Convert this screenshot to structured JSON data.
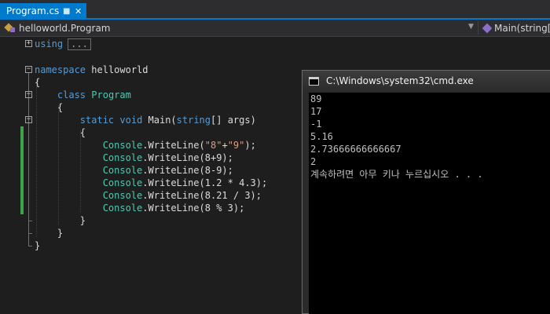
{
  "tabs": [
    {
      "label": "Program.cs",
      "pin_icon": "pin-icon",
      "close_icon": "close-icon"
    }
  ],
  "navbar": {
    "type_dropdown": "helloworld.Program",
    "member_dropdown": "Main(string[]"
  },
  "editor": {
    "using_keyword": "using",
    "using_collapsed": "...",
    "namespace_keyword": "namespace",
    "namespace_name": "helloworld",
    "class_keyword": "class",
    "class_name": "Program",
    "static_kw": "static",
    "void_kw": "void",
    "main_name": " Main(",
    "string_kw": "string",
    "args_text": "[] args)",
    "open_brace": "{",
    "close_brace": "}",
    "statements": [
      {
        "cls": "Console",
        "rest_pre": ".WriteLine(",
        "str": "\"8\"",
        "op": "+",
        "str2": "\"9\"",
        "rest_post": ");"
      },
      {
        "cls": "Console",
        "rest_pre": ".WriteLine(8+9);"
      },
      {
        "cls": "Console",
        "rest_pre": ".WriteLine(8-9);"
      },
      {
        "cls": "Console",
        "rest_pre": ".WriteLine(1.2 * 4.3);"
      },
      {
        "cls": "Console",
        "rest_pre": ".WriteLine(8.21 / 3);"
      },
      {
        "cls": "Console",
        "rest_pre": ".WriteLine(8 % 3);"
      }
    ]
  },
  "console": {
    "title": "C:\\Windows\\system32\\cmd.exe",
    "lines": [
      "89",
      "17",
      "-1",
      "5.16",
      "2.73666666666667",
      "2",
      "계속하려면 아무 키나 누르십시오 . . ."
    ]
  },
  "colors": {
    "accent": "#007acc",
    "keyword": "#569cd6",
    "type": "#4ec9b0",
    "string": "#d69d85",
    "change_bar": "#3ea34a"
  }
}
